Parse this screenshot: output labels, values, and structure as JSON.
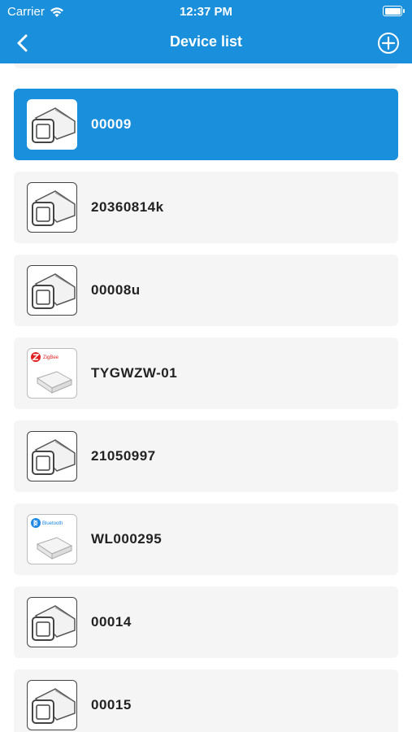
{
  "status_bar": {
    "carrier": "Carrier",
    "time": "12:37 PM"
  },
  "nav": {
    "title": "Device list",
    "back_icon": "chevron-left-icon",
    "add_icon": "plus-circle-icon"
  },
  "colors": {
    "primary": "#1a8fdc",
    "card_bg": "#f5f5f5",
    "text": "#222222"
  },
  "devices": [
    {
      "name": "",
      "icon": "gateway-icon",
      "selected": false
    },
    {
      "name": "00009",
      "icon": "lock-cylinder-icon",
      "selected": true
    },
    {
      "name": "20360814k",
      "icon": "lock-cylinder-icon",
      "selected": false
    },
    {
      "name": "00008u",
      "icon": "lock-cylinder-icon",
      "selected": false
    },
    {
      "name": "TYGWZW-01",
      "icon": "zigbee-gateway-icon",
      "selected": false,
      "badge": "ZigBee"
    },
    {
      "name": "21050997",
      "icon": "lock-cylinder-icon",
      "selected": false
    },
    {
      "name": "WL000295",
      "icon": "bluetooth-gateway-icon",
      "selected": false,
      "badge": "Bluetooth"
    },
    {
      "name": "00014",
      "icon": "lock-cylinder-icon",
      "selected": false
    },
    {
      "name": "00015",
      "icon": "lock-cylinder-icon",
      "selected": false
    }
  ]
}
